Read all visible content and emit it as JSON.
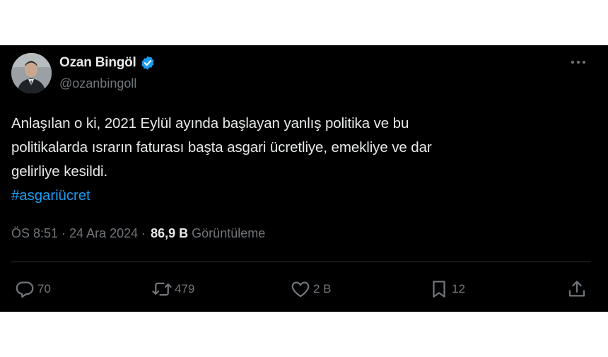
{
  "author": {
    "name": "Ozan Bingöl",
    "handle": "@ozanbingoll"
  },
  "tweet": {
    "lines": [
      "Anlaşılan o ki, 2021 Eylül ayında başlayan yanlış politika ve bu",
      "politikalarda ısrarın faturası başta asgari ücretliye, emekliye ve dar",
      "gelirliye kesildi."
    ],
    "hashtag": "#asgariücret"
  },
  "meta": {
    "time": "ÖS 8:51 · 24 Ara 2024 ·",
    "views_count": "86,9 B",
    "views_label": "Görüntüleme"
  },
  "actions": {
    "replies": "70",
    "reposts": "479",
    "likes": "2 B",
    "bookmarks": "12"
  },
  "colors": {
    "background": "#000000",
    "text": "#e7e9ea",
    "muted": "#71767b",
    "accent": "#1d9bf0"
  }
}
